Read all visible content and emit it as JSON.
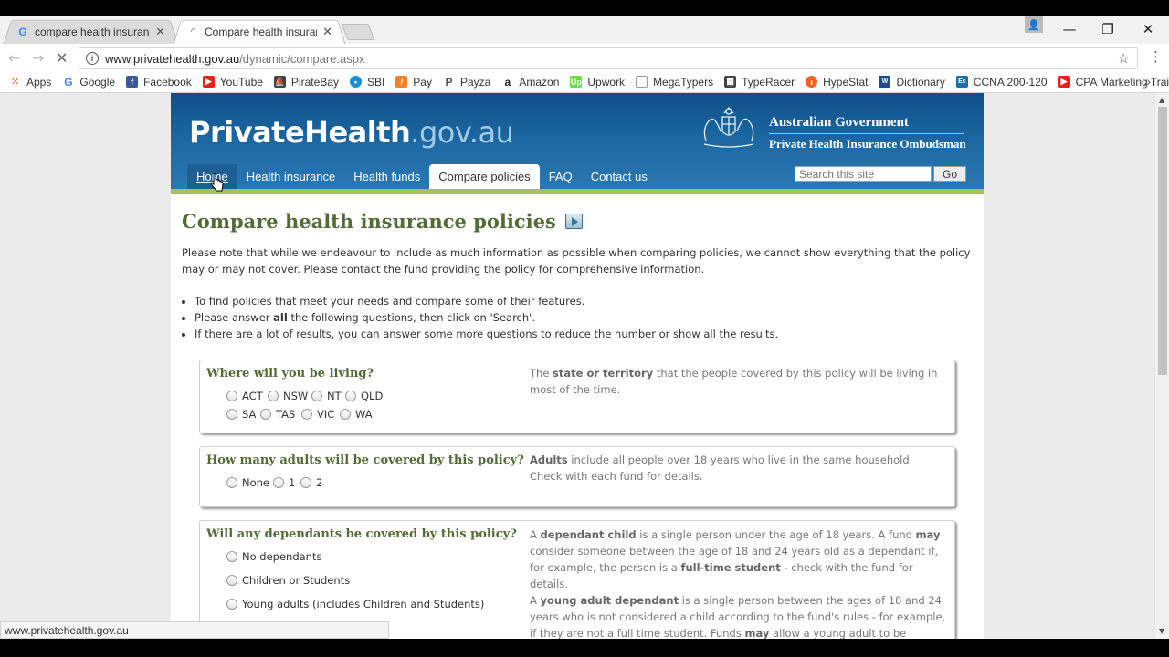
{
  "tabs": [
    {
      "title": "compare health insurance",
      "active": false
    },
    {
      "title": "Compare health insurance",
      "active": true
    }
  ],
  "address": {
    "host": "www.privatehealth.gov.au",
    "path": "/dynamic/compare.aspx"
  },
  "bookmarks": [
    {
      "label": "Apps",
      "icon": "apps-grid-icon",
      "color": "#e84c3d"
    },
    {
      "label": "Google",
      "icon": "google-icon",
      "color": "#4285f4"
    },
    {
      "label": "Facebook",
      "icon": "facebook-icon",
      "color": "#3b5998"
    },
    {
      "label": "YouTube",
      "icon": "youtube-icon",
      "color": "#e62117"
    },
    {
      "label": "PirateBay",
      "icon": "pirate-ship-icon",
      "color": "#444444"
    },
    {
      "label": "SBI",
      "icon": "sbi-icon",
      "color": "#1d8fd0"
    },
    {
      "label": "Pay",
      "icon": "pay-icon",
      "color": "#f0822b"
    },
    {
      "label": "Payza",
      "icon": "payza-icon",
      "color": "#555555"
    },
    {
      "label": "Amazon",
      "icon": "amazon-icon",
      "color": "#222222"
    },
    {
      "label": "Upwork",
      "icon": "upwork-icon",
      "color": "#6fda44"
    },
    {
      "label": "MegaTypers",
      "icon": "page-icon",
      "color": "#999999"
    },
    {
      "label": "TypeRacer",
      "icon": "typeracer-icon",
      "color": "#444444"
    },
    {
      "label": "HypeStat",
      "icon": "hypestat-icon",
      "color": "#f06423"
    },
    {
      "label": "Dictionary",
      "icon": "dictionary-icon",
      "color": "#1d4a8a"
    },
    {
      "label": "CCNA 200-120",
      "icon": "ccna-icon",
      "color": "#1d6fa5"
    },
    {
      "label": "CPA Marketing Trainin",
      "icon": "youtube-icon",
      "color": "#e62117"
    }
  ],
  "site": {
    "logo_main": "PrivateHealth",
    "logo_dot": ".",
    "logo_gov": "gov.au",
    "govt_line1": "Australian Government",
    "govt_line2": "Private Health Insurance Ombudsman",
    "nav": [
      "Home",
      "Health insurance",
      "Health funds",
      "Compare policies",
      "FAQ",
      "Contact us"
    ],
    "active_nav": "Compare policies",
    "search_placeholder": "Search this site",
    "search_button": "Go"
  },
  "main": {
    "title": "Compare health insurance policies",
    "intro": "Please note that while we endeavour to include as much information as possible when comparing policies, we cannot show everything that the policy may or may not cover. Please contact the fund providing the policy for comprehensive information.",
    "bullet1": "To find policies that meet your needs and compare some of their features.",
    "bullet2_pre": "Please answer ",
    "bullet2_bold": "all",
    "bullet2_post": " the following questions, then click on 'Search'.",
    "bullet3": "If there are a lot of results, you can answer some more questions to reduce the number or show all the results."
  },
  "q_living": {
    "question": "Where will you be living?",
    "help_pre": "The ",
    "help_bold": "state or territory",
    "help_post": " that the people covered by this policy will be living in most of the time.",
    "options": [
      "ACT",
      "NSW",
      "NT",
      "QLD",
      "SA",
      "TAS",
      "VIC",
      "WA"
    ]
  },
  "q_adults": {
    "question": "How many adults will be covered by this policy?",
    "help_bold": "Adults",
    "help_post": " include all people over 18 years who live in the same household. Check with each fund for details.",
    "options": [
      "None",
      "1",
      "2"
    ]
  },
  "q_dependants": {
    "question": "Will any dependants be covered by this policy?",
    "options": [
      "No dependants",
      "Children or Students",
      "Young adults (includes Children and Students)"
    ],
    "help1_a": "A ",
    "help1_b": "dependant child",
    "help1_c": " is a single person under the age of 18 years. A fund ",
    "help1_d": "may",
    "help1_e": " consider someone between the age of 18 and 24 years old as a dependant if, for example, the person is a ",
    "help1_f": "full-time student",
    "help1_g": " - check with the fund for details.",
    "help2_a": "A ",
    "help2_b": "young adult dependant",
    "help2_c": " is a single person between the ages of 18 and 24 years who is not considered a child according to the fund's rules - for example, if they are not a full time student. Funds ",
    "help2_d": "may",
    "help2_e": " allow a young adult to be covered on the same"
  },
  "status_url": "www.privatehealth.gov.au"
}
